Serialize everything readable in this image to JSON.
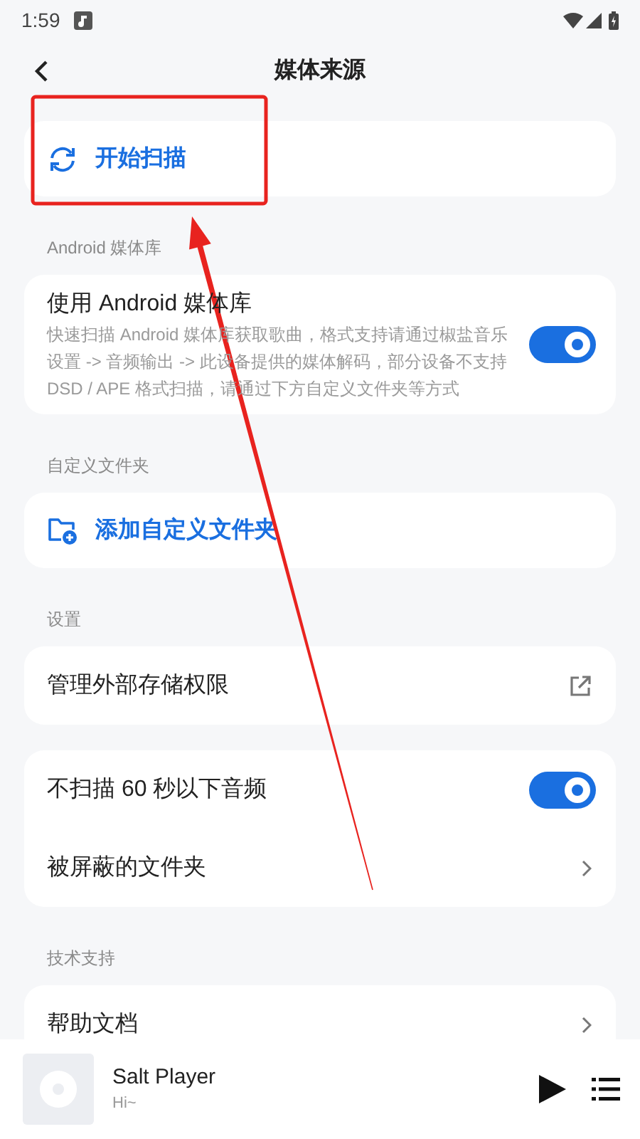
{
  "status_bar": {
    "time": "1:59"
  },
  "header": {
    "title": "媒体来源"
  },
  "sections": [
    {
      "items": [
        {
          "kind": "scan",
          "title": "开始扫描"
        }
      ]
    },
    {
      "label": "Android 媒体库",
      "items": [
        {
          "kind": "toggle",
          "title": "使用 Android 媒体库",
          "description": "快速扫描 Android 媒体库获取歌曲，格式支持请通过椒盐音乐设置 -> 音频输出 -> 此设备提供的媒体解码，部分设备不支持 DSD / APE 格式扫描，请通过下方自定义文件夹等方式",
          "on": true
        }
      ]
    },
    {
      "label": "自定义文件夹",
      "items": [
        {
          "kind": "addfolder",
          "title": "添加自定义文件夹"
        }
      ]
    },
    {
      "label": "设置",
      "items": [
        {
          "kind": "external",
          "title": "管理外部存储权限"
        }
      ]
    },
    {
      "items": [
        {
          "kind": "toggle",
          "title": "不扫描 60 秒以下音频",
          "on": true
        },
        {
          "kind": "nav",
          "title": "被屏蔽的文件夹"
        }
      ]
    },
    {
      "label": "技术支持",
      "items": [
        {
          "kind": "nav",
          "title": "帮助文档"
        }
      ]
    }
  ],
  "player": {
    "title": "Salt Player",
    "subtitle": "Hi~"
  }
}
